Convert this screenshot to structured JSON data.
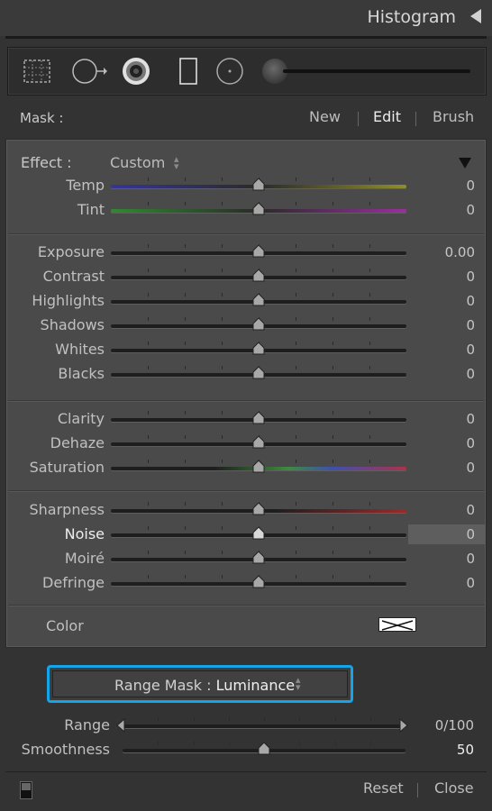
{
  "header": {
    "title": "Histogram"
  },
  "toolbar": {
    "tools": [
      "crop-overlay-icon",
      "spot-removal-icon",
      "red-eye-icon",
      "graduated-filter-icon",
      "radial-filter-icon"
    ]
  },
  "mask": {
    "label": "Mask :",
    "new": "New",
    "edit": "Edit",
    "brush": "Brush"
  },
  "effect": {
    "label": "Effect :",
    "value": "Custom",
    "caret": "◆"
  },
  "groups": [
    {
      "rows": [
        {
          "id": "temp",
          "label": "Temp",
          "value": "0",
          "position": 0.5,
          "track": "temp"
        },
        {
          "id": "tint",
          "label": "Tint",
          "value": "0",
          "position": 0.5,
          "track": "tint"
        }
      ]
    },
    {
      "rows": [
        {
          "id": "exposure",
          "label": "Exposure",
          "value": "0.00",
          "position": 0.5,
          "track": "dark"
        },
        {
          "id": "contrast",
          "label": "Contrast",
          "value": "0",
          "position": 0.5,
          "track": "dark"
        },
        {
          "id": "highlights",
          "label": "Highlights",
          "value": "0",
          "position": 0.5,
          "track": "dark"
        },
        {
          "id": "shadows",
          "label": "Shadows",
          "value": "0",
          "position": 0.5,
          "track": "dark"
        },
        {
          "id": "whites",
          "label": "Whites",
          "value": "0",
          "position": 0.5,
          "track": "dark"
        },
        {
          "id": "blacks",
          "label": "Blacks",
          "value": "0",
          "position": 0.5,
          "track": "dark"
        }
      ]
    },
    {
      "rows": [
        {
          "id": "clarity",
          "label": "Clarity",
          "value": "0",
          "position": 0.5,
          "track": "dark"
        },
        {
          "id": "dehaze",
          "label": "Dehaze",
          "value": "0",
          "position": 0.5,
          "track": "dark"
        },
        {
          "id": "saturation",
          "label": "Saturation",
          "value": "0",
          "position": 0.5,
          "track": "saturation"
        }
      ]
    },
    {
      "rows": [
        {
          "id": "sharpness",
          "label": "Sharpness",
          "value": "0",
          "position": 0.5,
          "track": "sharpness"
        },
        {
          "id": "noise",
          "label": "Noise",
          "value": "0",
          "position": 0.5,
          "track": "dark",
          "active": true
        },
        {
          "id": "moire",
          "label": "Moiré",
          "value": "0",
          "position": 0.5,
          "track": "dark"
        },
        {
          "id": "defringe",
          "label": "Defringe",
          "value": "0",
          "position": 0.5,
          "track": "dark"
        }
      ]
    }
  ],
  "color": {
    "label": "Color"
  },
  "range_mask": {
    "prefix": "Range Mask : ",
    "value": "Luminance",
    "caret": "◆",
    "highlight": "#13a5e8"
  },
  "range_controls": [
    {
      "id": "range",
      "label": "Range",
      "value": "0/100",
      "low": 0.0,
      "high": 1.0
    },
    {
      "id": "smoothness",
      "label": "Smoothness",
      "value": "50",
      "position": 0.5
    }
  ],
  "footer": {
    "reset": "Reset",
    "close": "Close"
  }
}
